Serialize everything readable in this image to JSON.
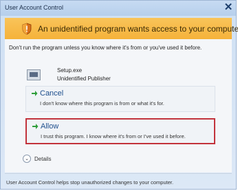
{
  "window": {
    "title": "User Account Control",
    "close_label": "✕"
  },
  "banner": {
    "text": "An unidentified program wants access to your computer",
    "icon": "shield-warning-icon"
  },
  "warning": {
    "text": "Don't run the program unless you know where it's from or you've used it before."
  },
  "program": {
    "name": "Setup.exe",
    "publisher": "Unidentified Publisher",
    "icon": "program-icon"
  },
  "options": [
    {
      "title": "Cancel",
      "description": "I don't know where this program is from or what it's for.",
      "icon": "green-arrow-icon"
    },
    {
      "title": "Allow",
      "description": "I trust this program. I know where it's from or I've used it before.",
      "icon": "green-arrow-icon"
    }
  ],
  "details": {
    "label": "Details",
    "icon": "chevron-down-icon"
  },
  "footer": {
    "text": "User Account Control helps stop unauthorized changes to your computer."
  },
  "colors": {
    "banner": "#f5b23a",
    "allow_border": "#c2323b",
    "option_title": "#1e4f8d"
  }
}
